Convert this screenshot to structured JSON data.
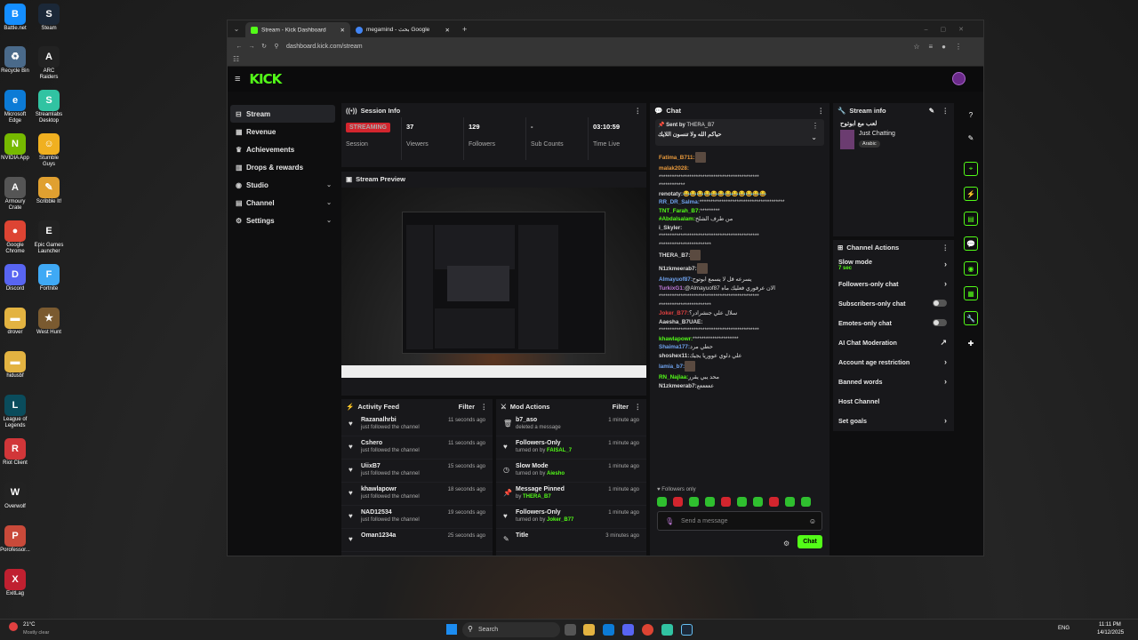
{
  "desktop": {
    "icons": [
      {
        "label": "Battle.net",
        "color": "#148eff",
        "glyph": "B"
      },
      {
        "label": "Steam",
        "color": "#1b2838",
        "glyph": "S"
      },
      {
        "label": "Recycle Bin",
        "color": "#4a6a8a",
        "glyph": "♻"
      },
      {
        "label": "ARC Raiders",
        "color": "#222",
        "glyph": "A"
      },
      {
        "label": "Microsoft Edge",
        "color": "#0c7bd6",
        "glyph": "e"
      },
      {
        "label": "Streamlabs Desktop",
        "color": "#31c3a2",
        "glyph": "S"
      },
      {
        "label": "NVIDIA App",
        "color": "#76b900",
        "glyph": "N"
      },
      {
        "label": "Stumble Guys",
        "color": "#f0b020",
        "glyph": "☺"
      },
      {
        "label": "Armoury Crate",
        "color": "#555",
        "glyph": "A"
      },
      {
        "label": "Scribble It!",
        "color": "#e0a030",
        "glyph": "✎"
      },
      {
        "label": "Google Chrome",
        "color": "#dd4433",
        "glyph": "●"
      },
      {
        "label": "Epic Games Launcher",
        "color": "#222",
        "glyph": "E"
      },
      {
        "label": "Discord",
        "color": "#5865f2",
        "glyph": "D"
      },
      {
        "label": "Fortnite",
        "color": "#3fa9f5",
        "glyph": "F"
      },
      {
        "label": "drover",
        "color": "#e3b341",
        "glyph": "▬"
      },
      {
        "label": "West Hunt",
        "color": "#7a5a30",
        "glyph": "★"
      },
      {
        "label": "hidusbf",
        "color": "#e3b341",
        "glyph": "▬"
      },
      {
        "label": "League of Legends",
        "color": "#0a4c5c",
        "glyph": "L"
      },
      {
        "label": "Riot Client",
        "color": "#d13639",
        "glyph": "R"
      },
      {
        "label": "Overwolf",
        "color": "#222",
        "glyph": "W"
      },
      {
        "label": "Porofessor...",
        "color": "#c94a3a",
        "glyph": "P"
      },
      {
        "label": "ExitLag",
        "color": "#c02030",
        "glyph": "X"
      }
    ]
  },
  "browser": {
    "tabs": [
      {
        "title": "Stream - Kick Dashboard",
        "favicon_color": "#53fc18"
      },
      {
        "title": "megamind - بحث Google",
        "favicon_color": "#4285f4"
      }
    ],
    "url": "dashboard.kick.com/stream"
  },
  "kick": {
    "logo": "KICK",
    "sidebar": [
      {
        "label": "Stream",
        "icon": "⊟",
        "active": true,
        "expand": false
      },
      {
        "label": "Revenue",
        "icon": "▦",
        "active": false,
        "expand": false
      },
      {
        "label": "Achievements",
        "icon": "♛",
        "active": false,
        "expand": false
      },
      {
        "label": "Drops & rewards",
        "icon": "▥",
        "active": false,
        "expand": false
      },
      {
        "label": "Studio",
        "icon": "◉",
        "active": false,
        "expand": true
      },
      {
        "label": "Channel",
        "icon": "▤",
        "active": false,
        "expand": true
      },
      {
        "label": "Settings",
        "icon": "⚙",
        "active": false,
        "expand": true
      }
    ],
    "session": {
      "title": "Session Info",
      "status_badge": "STREAMING",
      "status_label": "Session",
      "stats": [
        {
          "value": "37",
          "label": "Viewers"
        },
        {
          "value": "129",
          "label": "Followers"
        },
        {
          "value": "-",
          "label": "Sub Counts"
        },
        {
          "value": "03:10:59",
          "label": "Time Live"
        }
      ]
    },
    "preview": {
      "title": "Stream Preview"
    },
    "activity": {
      "title": "Activity Feed",
      "filter": "Filter",
      "items": [
        {
          "name": "Razanalhrbi",
          "sub": "just followed the channel",
          "time": "11 seconds ago"
        },
        {
          "name": "Cshero",
          "sub": "just followed the channel",
          "time": "11 seconds ago"
        },
        {
          "name": "UiixB7",
          "sub": "just followed the channel",
          "time": "15 seconds ago"
        },
        {
          "name": "khawlapowr",
          "sub": "just followed the channel",
          "time": "18 seconds ago"
        },
        {
          "name": "NAD12534",
          "sub": "just followed the channel",
          "time": "19 seconds ago"
        },
        {
          "name": "Oman1234a",
          "sub": "",
          "time": "25 seconds ago"
        }
      ]
    },
    "mod": {
      "title": "Mod Actions",
      "filter": "Filter",
      "items": [
        {
          "name": "b7_aso",
          "sub": "deleted a message",
          "by": "",
          "time": "1 minute ago",
          "icon": "🗑"
        },
        {
          "name": "Followers-Only",
          "sub": "turned on by ",
          "by": "FAISAL_7",
          "time": "1 minute ago",
          "icon": "♥"
        },
        {
          "name": "Slow Mode",
          "sub": "turned on by ",
          "by": "Aiesho",
          "time": "1 minute ago",
          "icon": "◷"
        },
        {
          "name": "Message Pinned",
          "sub": "by ",
          "by": "THERA_B7",
          "time": "1 minute ago",
          "icon": "📌"
        },
        {
          "name": "Followers-Only",
          "sub": "turned on by ",
          "by": "Joker_B77",
          "time": "1 minute ago",
          "icon": "♥"
        },
        {
          "name": "Title",
          "sub": "",
          "by": "",
          "time": "3 minutes ago",
          "icon": "✎"
        }
      ]
    },
    "chat": {
      "title": "Chat",
      "pinned_label": "Sent by",
      "pinned_user": "THERA_B7",
      "pinned_text": "حياكم الله ولا تنسون اللايك",
      "messages": [
        {
          "user": "Fatima_B711:",
          "color": "#e99a3c",
          "text": "",
          "emote": true
        },
        {
          "user": "malak2028:",
          "color": "#e99a3c",
          "text": "",
          "emote": false
        },
        {
          "user": "",
          "color": "#ddd",
          "text": "**********************************************",
          "emote": false
        },
        {
          "user": "",
          "color": "#ddd",
          "text": "************",
          "emote": false
        },
        {
          "user": "renotaty:",
          "color": "#ddd",
          "text": "😂😂😂😂😂😂😂😂😂😂😂😂",
          "emote": false
        },
        {
          "user": "RR_DR_Salma:",
          "color": "#6fa3ef",
          "text": "***************************************",
          "emote": false
        },
        {
          "user": "TNT_Farah_B7:",
          "color": "#53fc18",
          "text": "*********",
          "emote": false
        },
        {
          "user": "#Abdalsalam:",
          "color": "#53fc18",
          "text": "من طرف الشلخ",
          "emote": false
        },
        {
          "user": "i_Skyler:",
          "color": "#ddd",
          "text": "",
          "emote": false
        },
        {
          "user": "",
          "color": "#ddd",
          "text": "**********************************************",
          "emote": false
        },
        {
          "user": "",
          "color": "#ddd",
          "text": "************************",
          "emote": false
        },
        {
          "user": "THERA_B7:",
          "color": "#ddd",
          "text": "",
          "emote": true
        },
        {
          "user": "N1zkmeerab7:",
          "color": "#ddd",
          "text": "",
          "emote": true
        },
        {
          "user": "Almayuof87:",
          "color": "#6fa3ef",
          "text": "يسرعه قل لا يسمع ابوتوح",
          "emote": false
        },
        {
          "user": "TurkixG1:",
          "color": "#c07ad8",
          "text": "@Almayuof87 الان عرفوري فعليك ماه",
          "emote": false
        },
        {
          "user": "",
          "color": "#ddd",
          "text": "**********************************************",
          "emote": false
        },
        {
          "user": "",
          "color": "#ddd",
          "text": "************************",
          "emote": false
        },
        {
          "user": "Joker_B77:",
          "color": "#e04040",
          "text": "سلال علي جنشرادر؟",
          "emote": false
        },
        {
          "user": "Aaesha_B7UAE:",
          "color": "#ddd",
          "text": "",
          "emote": false
        },
        {
          "user": "",
          "color": "#ddd",
          "text": "**********************************************",
          "emote": false
        },
        {
          "user": "khawlapowr:",
          "color": "#53fc18",
          "text": "*********************",
          "emote": false
        },
        {
          "user": "Shaima177:",
          "color": "#6fa3ef",
          "text": "حطي مرد",
          "emote": false
        },
        {
          "user": "shoshex11:",
          "color": "#ddd",
          "text": "علي دلوي عووريا يجيك",
          "emote": false
        },
        {
          "user": "lamia_b7:",
          "color": "#6fa3ef",
          "text": "",
          "emote": true
        },
        {
          "user": "RN_Najlaa:",
          "color": "#53fc18",
          "text": "محد يبي يقرر",
          "emote": false
        },
        {
          "user": "N1zkmeerab7:",
          "color": "#ddd",
          "text": "عععععع",
          "emote": false
        }
      ],
      "mode": "Followers only",
      "placeholder": "Send a message",
      "send": "Chat"
    },
    "stream_info": {
      "title": "Stream info",
      "stream_title": "لعب مع ابوتوح",
      "category": "Just Chatting",
      "tag": "Arabic"
    },
    "actions": {
      "title": "Channel Actions",
      "items": [
        {
          "label": "Slow mode",
          "sub": "7 sec",
          "kind": "arrow"
        },
        {
          "label": "Followers-only chat",
          "sub": "",
          "kind": "arrow"
        },
        {
          "label": "Subscribers-only chat",
          "sub": "",
          "kind": "toggle"
        },
        {
          "label": "Emotes-only chat",
          "sub": "",
          "kind": "toggle"
        },
        {
          "label": "AI Chat Moderation",
          "sub": "",
          "kind": "ext"
        },
        {
          "label": "Account age restriction",
          "sub": "",
          "kind": "arrow"
        },
        {
          "label": "Banned words",
          "sub": "",
          "kind": "arrow"
        },
        {
          "label": "Host Channel",
          "sub": "",
          "kind": "none"
        },
        {
          "label": "Set goals",
          "sub": "",
          "kind": "arrow"
        }
      ]
    }
  },
  "taskbar": {
    "weather_temp": "21°C",
    "weather_desc": "Mostly clear",
    "search": "Search",
    "lang": "ENG",
    "time": "11:11 PM",
    "date": "14/12/2025"
  }
}
